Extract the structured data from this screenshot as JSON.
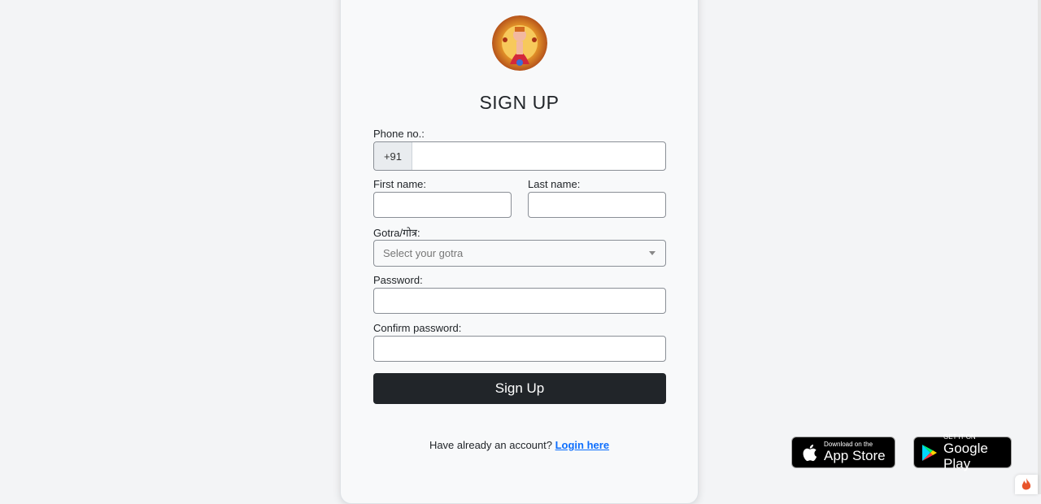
{
  "form": {
    "title": "SIGN UP",
    "phone_label": "Phone no.:",
    "phone_prefix": "+91",
    "phone_value": "",
    "first_name_label": "First name:",
    "first_name_value": "",
    "last_name_label": "Last name:",
    "last_name_value": "",
    "gotra_label": "Gotra/गोत्र:",
    "gotra_placeholder": "Select your gotra",
    "password_label": "Password:",
    "confirm_password_label": "Confirm password:",
    "submit_label": "Sign Up",
    "login_prompt": "Have already an account?",
    "login_link": "Login here"
  },
  "stores": {
    "apple_small": "Download on the",
    "apple_big": "App Store",
    "google_small": "GET IT ON",
    "google_big": "Google Play"
  },
  "colors": {
    "button_bg": "#212529",
    "link": "#0d6efd",
    "card_bg": "#f8f9fa",
    "page_bg": "#f3f4f6"
  },
  "icons": {
    "logo": "deity-logo",
    "apple": "apple-icon",
    "google_play": "google-play-icon",
    "dropdown": "chevron-down-icon",
    "corner": "flame-icon"
  }
}
